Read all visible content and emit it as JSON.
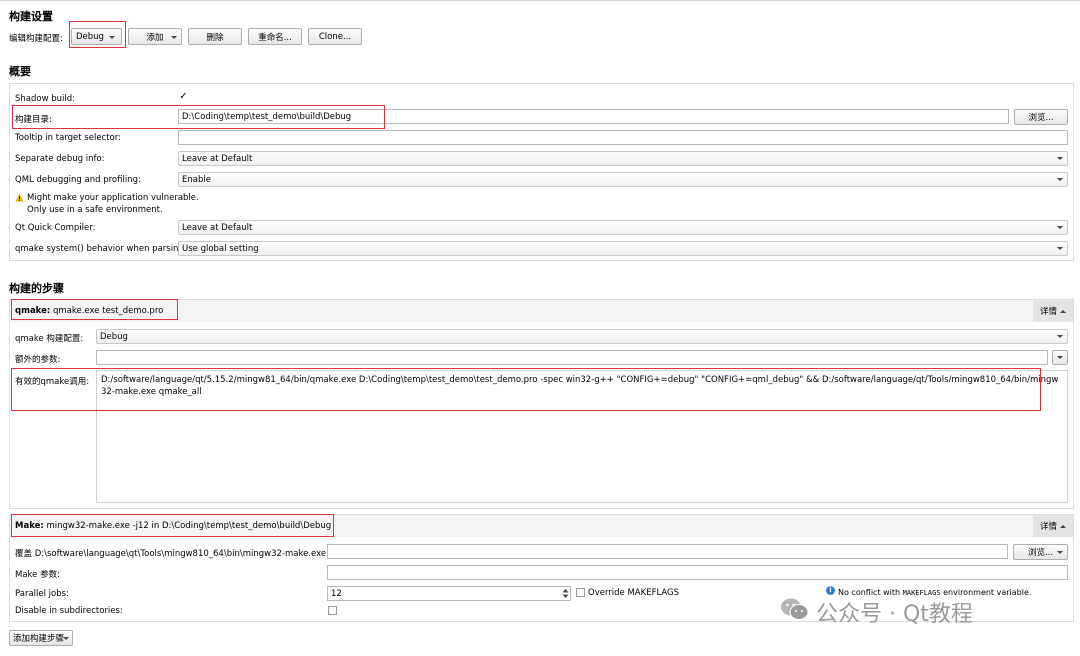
{
  "build_settings": {
    "heading": "构建设置",
    "edit_config_label": "编辑构建配置:",
    "config_value": "Debug",
    "add_label": "添加",
    "delete_label": "删除",
    "rename_label": "重命名...",
    "clone_label": "Clone..."
  },
  "overview": {
    "heading": "概要",
    "shadow_build_label": "Shadow build:",
    "shadow_build_checked": "✓",
    "build_dir_label": "构建目录:",
    "build_dir_value": "D:\\Coding\\temp\\test_demo\\build\\Debug",
    "browse_label": "浏览...",
    "tooltip_label": "Tooltip in target selector:",
    "tooltip_value": "",
    "separate_debug_label": "Separate debug info:",
    "separate_debug_value": "Leave at Default",
    "qml_debug_label": "QML debugging and profiling:",
    "qml_debug_value": "Enable",
    "warning_line1": "Might make your application vulnerable.",
    "warning_line2": "Only use in a safe environment.",
    "qt_quick_label": "Qt Quick Compiler:",
    "qt_quick_value": "Leave at Default",
    "qmake_system_label": "qmake system() behavior when parsing:",
    "qmake_system_value": "Use global setting"
  },
  "build_steps": {
    "heading": "构建的步骤",
    "qmake_title_bold": "qmake:",
    "qmake_title_rest": " qmake.exe test_demo.pro",
    "details_label": "详情",
    "qmake_config_label": "qmake 构建配置:",
    "qmake_config_value": "Debug",
    "extra_args_label": "额外的参数:",
    "extra_args_value": "",
    "effective_call_label": "有效的qmake调用:",
    "effective_call_value": "D:/software/language/qt/5.15.2/mingw81_64/bin/qmake.exe D:\\Coding\\temp\\test_demo\\test_demo.pro -spec win32-g++ \"CONFIG+=debug\" \"CONFIG+=qml_debug\" && D:/software/language/qt/Tools/mingw810_64/bin/mingw32-make.exe qmake_all",
    "make_title_bold": "Make:",
    "make_title_rest": " mingw32-make.exe -j12 in D:\\Coding\\temp\\test_demo\\build\\Debug",
    "override_label": "覆盖 D:\\software\\language\\qt\\Tools\\mingw810_64\\bin\\mingw32-make.exe:",
    "override_value": "",
    "make_args_label": "Make 参数:",
    "make_args_value": "",
    "parallel_jobs_label": "Parallel jobs:",
    "parallel_jobs_value": "12",
    "override_makeflags_label": "Override MAKEFLAGS",
    "no_conflict_prefix": "No conflict with ",
    "no_conflict_var": "MAKEFLAGS",
    "no_conflict_suffix": " environment variable.",
    "disable_subdirs_label": "Disable in subdirectories:",
    "add_step_label": "添加构建步骤"
  },
  "watermark": {
    "text": "公众号 · Qt教程"
  },
  "colors": {
    "highlight": "#e0323c",
    "warning": "#f0b400",
    "info": "#2d7fd3"
  }
}
